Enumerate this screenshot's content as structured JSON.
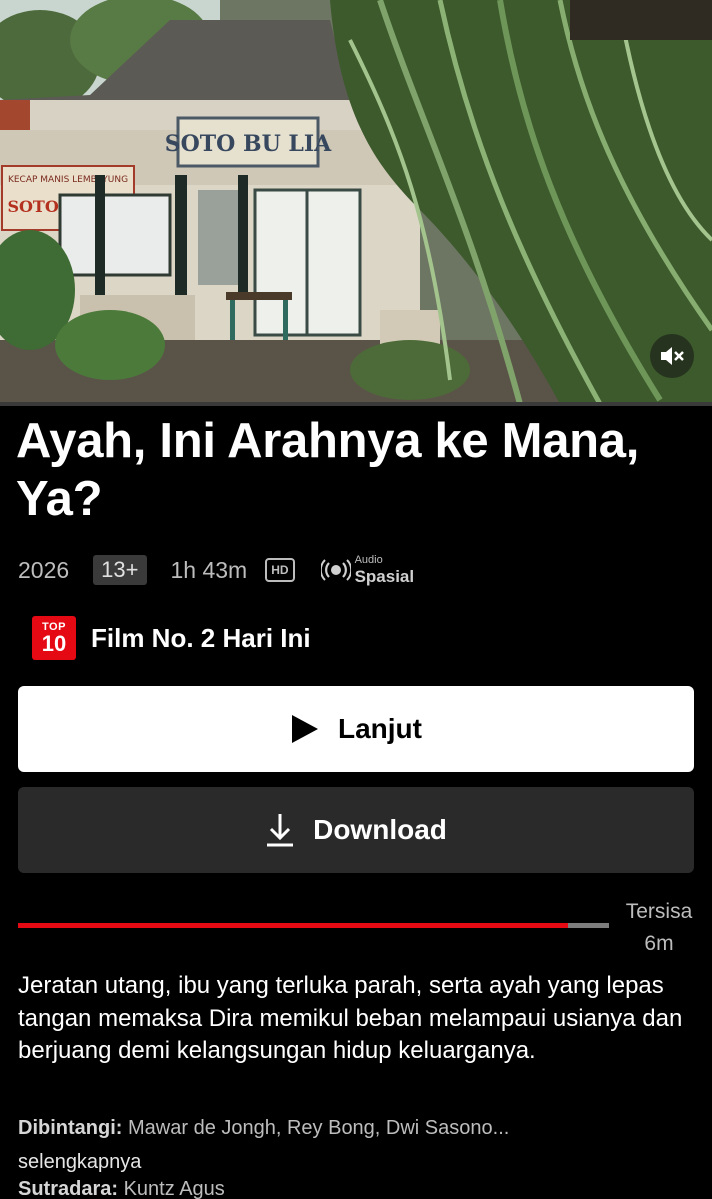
{
  "hero": {
    "sign_main": "SOTO BU LIA",
    "sign_banner_top": "KECAP MANIS LEMBAYUNG",
    "sign_banner_main": "SOTO BU LIA",
    "playback_progress": 0.0,
    "mute_icon": "volume-mute-icon"
  },
  "title": "Ayah, Ini Arahnya ke Mana, Ya?",
  "meta": {
    "year": "2026",
    "rating": "13+",
    "duration": "1h 43m",
    "hd": "HD",
    "audio_top": "Audio",
    "audio_bottom": "Spasial"
  },
  "top10": {
    "badge_top": "TOP",
    "badge_num": "10",
    "text": "Film No. 2 Hari Ini"
  },
  "buttons": {
    "play_label": "Lanjut",
    "download_label": "Download"
  },
  "progress": {
    "watched_fraction": 0.93,
    "remaining_label_1": "Tersisa",
    "remaining_label_2": "6m"
  },
  "description": "Jeratan utang, ibu yang terluka parah, serta ayah yang lepas tangan memaksa Dira memikul beban melampaui usianya dan berjuang demi kelangsungan hidup keluarganya.",
  "cast": {
    "label": "Dibintangi:",
    "names": "Mawar de Jongh, Rey Bong, Dwi Sasono..."
  },
  "more_label": "selengkapnya",
  "director": {
    "label": "Sutradara:",
    "name": "Kuntz Agus"
  },
  "colors": {
    "accent": "#e50914",
    "background": "#000000",
    "button_primary": "#ffffff",
    "button_secondary": "#2a2a2a"
  }
}
